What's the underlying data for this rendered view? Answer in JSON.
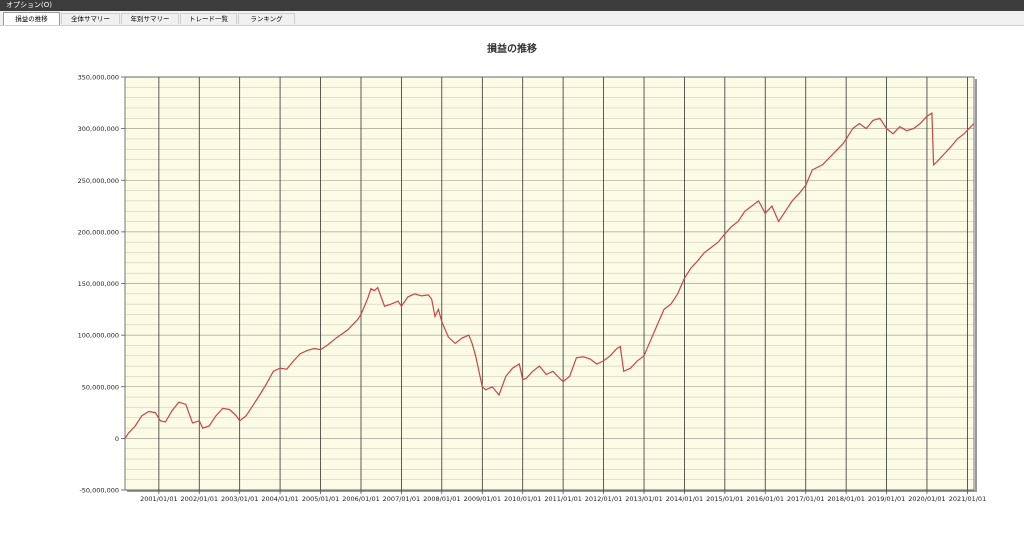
{
  "window": {
    "title": "オプション(O)"
  },
  "tabs": [
    {
      "label": "損益の推移",
      "active": true
    },
    {
      "label": "全体サマリー",
      "active": false
    },
    {
      "label": "年別サマリー",
      "active": false
    },
    {
      "label": "トレード一覧",
      "active": false
    },
    {
      "label": "ランキング",
      "active": false
    }
  ],
  "colors": {
    "plot_bg": "#fcfce6",
    "line": "#cc4444",
    "grid": "#b5b5a0",
    "vline": "#333333"
  },
  "chart_data": {
    "type": "line",
    "title": "損益の推移",
    "xlabel": "",
    "ylabel": "",
    "ylim": [
      -50000000,
      350000000
    ],
    "xlim": [
      "2000-03-01",
      "2021-03-01"
    ],
    "y_ticks": [
      "350,000,000",
      "300,000,000",
      "250,000,000",
      "200,000,000",
      "150,000,000",
      "100,000,000",
      "50,000,000",
      "0",
      "-50,000,000"
    ],
    "y_tick_values": [
      350000000,
      300000000,
      250000000,
      200000000,
      150000000,
      100000000,
      50000000,
      0,
      -50000000
    ],
    "x_ticks": [
      "2001/01/01",
      "2002/01/01",
      "2003/01/01",
      "2004/01/01",
      "2005/01/01",
      "2006/01/01",
      "2007/01/01",
      "2008/01/01",
      "2009/01/01",
      "2010/01/01",
      "2011/01/01",
      "2012/01/01",
      "2013/01/01",
      "2014/01/01",
      "2015/01/01",
      "2016/01/01",
      "2017/01/01",
      "2018/01/01",
      "2019/01/01",
      "2020/01/01",
      "2021/01/01"
    ],
    "grid": true,
    "minor_y_step": 10000000,
    "series": [
      {
        "x": [
          "2000-03-01",
          "2000-04-01",
          "2000-06-01",
          "2000-08-01",
          "2000-10-01",
          "2000-12-01",
          "2001-01-15",
          "2001-03-01",
          "2001-05-01",
          "2001-07-01",
          "2001-09-01",
          "2001-11-01",
          "2002-01-01",
          "2002-02-01",
          "2002-04-01",
          "2002-06-01",
          "2002-08-01",
          "2002-10-01",
          "2002-12-01",
          "2003-01-01",
          "2003-03-01",
          "2003-05-01",
          "2003-07-01",
          "2003-09-01",
          "2003-11-01",
          "2004-01-01",
          "2004-03-01",
          "2004-05-01",
          "2004-07-01",
          "2004-09-01",
          "2004-11-01",
          "2005-01-01",
          "2005-03-01",
          "2005-06-01",
          "2005-09-01",
          "2005-12-01",
          "2006-01-01",
          "2006-03-01",
          "2006-04-01",
          "2006-05-01",
          "2006-06-01",
          "2006-08-01",
          "2006-10-01",
          "2006-12-01",
          "2007-01-01",
          "2007-03-01",
          "2007-05-01",
          "2007-07-01",
          "2007-09-01",
          "2007-10-01",
          "2007-11-01",
          "2007-12-01",
          "2008-01-01",
          "2008-03-01",
          "2008-05-01",
          "2008-07-01",
          "2008-09-01",
          "2008-10-01",
          "2008-11-01",
          "2009-01-01",
          "2009-02-01",
          "2009-04-01",
          "2009-06-01",
          "2009-08-01",
          "2009-10-01",
          "2009-12-01",
          "2010-01-01",
          "2010-02-01",
          "2010-04-01",
          "2010-06-01",
          "2010-08-01",
          "2010-10-01",
          "2010-12-01",
          "2011-01-01",
          "2011-03-01",
          "2011-05-01",
          "2011-07-01",
          "2011-09-01",
          "2011-11-01",
          "2012-01-01",
          "2012-03-01",
          "2012-05-01",
          "2012-06-01",
          "2012-07-01",
          "2012-09-01",
          "2012-11-01",
          "2013-01-01",
          "2013-03-01",
          "2013-05-01",
          "2013-07-01",
          "2013-09-01",
          "2013-11-01",
          "2014-01-01",
          "2014-03-01",
          "2014-05-01",
          "2014-07-01",
          "2014-09-01",
          "2014-11-01",
          "2015-01-01",
          "2015-03-01",
          "2015-05-01",
          "2015-07-01",
          "2015-09-01",
          "2015-11-01",
          "2016-01-01",
          "2016-03-01",
          "2016-05-01",
          "2016-07-01",
          "2016-09-01",
          "2016-11-01",
          "2017-01-01",
          "2017-03-01",
          "2017-06-01",
          "2017-09-01",
          "2017-12-01",
          "2018-01-01",
          "2018-03-01",
          "2018-05-01",
          "2018-07-01",
          "2018-09-01",
          "2018-11-01",
          "2019-01-01",
          "2019-03-01",
          "2019-05-01",
          "2019-07-01",
          "2019-09-01",
          "2019-11-01",
          "2020-01-01",
          "2020-02-15",
          "2020-03-01",
          "2020-04-01",
          "2020-06-01",
          "2020-08-01",
          "2020-10-01",
          "2020-12-01",
          "2021-01-15",
          "2021-03-01"
        ],
        "y": [
          0,
          5000000,
          12000000,
          22000000,
          26000000,
          25000000,
          17000000,
          16000000,
          27000000,
          35000000,
          33000000,
          15000000,
          17000000,
          10000000,
          12000000,
          22000000,
          29000000,
          28000000,
          22000000,
          17000000,
          22000000,
          32000000,
          42000000,
          53000000,
          65000000,
          68000000,
          67000000,
          75000000,
          82000000,
          85000000,
          87000000,
          86000000,
          90000000,
          98000000,
          105000000,
          115000000,
          120000000,
          135000000,
          145000000,
          143000000,
          146000000,
          128000000,
          130000000,
          133000000,
          128000000,
          137000000,
          140000000,
          138000000,
          139000000,
          135000000,
          118000000,
          125000000,
          113000000,
          98000000,
          92000000,
          97000000,
          100000000,
          92000000,
          80000000,
          50000000,
          47000000,
          50000000,
          42000000,
          60000000,
          68000000,
          72000000,
          57000000,
          58000000,
          65000000,
          70000000,
          62000000,
          65000000,
          58000000,
          55000000,
          60000000,
          78000000,
          79000000,
          77000000,
          72000000,
          75000000,
          80000000,
          87000000,
          89000000,
          65000000,
          68000000,
          75000000,
          80000000,
          95000000,
          110000000,
          125000000,
          130000000,
          140000000,
          155000000,
          165000000,
          172000000,
          180000000,
          185000000,
          190000000,
          198000000,
          205000000,
          210000000,
          220000000,
          225000000,
          230000000,
          218000000,
          225000000,
          210000000,
          220000000,
          230000000,
          237000000,
          245000000,
          260000000,
          265000000,
          275000000,
          285000000,
          290000000,
          300000000,
          305000000,
          300000000,
          308000000,
          310000000,
          300000000,
          295000000,
          302000000,
          298000000,
          300000000,
          305000000,
          312000000,
          315000000,
          265000000,
          268000000,
          275000000,
          282000000,
          290000000,
          295000000,
          300000000,
          305000000
        ]
      }
    ]
  }
}
